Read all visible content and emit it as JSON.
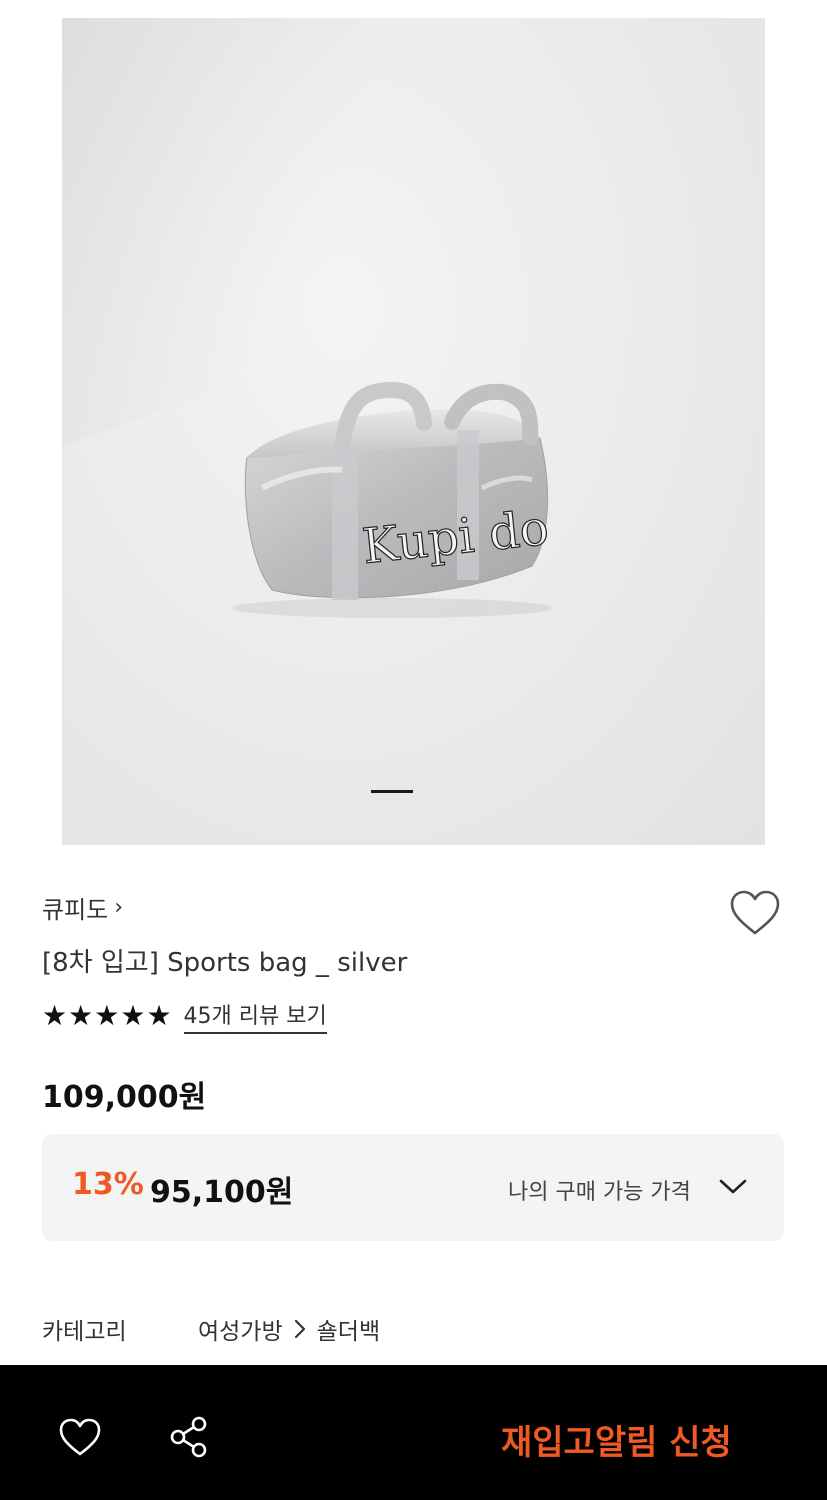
{
  "product_image": {
    "logo_text": "Kupi do",
    "carousel": {
      "current_index": 1,
      "total": 1
    }
  },
  "brand": {
    "name": "큐피도",
    "chevron": "›",
    "chevron_icon": "chevron-right-icon"
  },
  "wishlist_top": {
    "icon": "heart-outline-icon"
  },
  "product": {
    "title": "[8차 입고] Sports bag _ silver",
    "rating": {
      "stars": 5,
      "max": 5,
      "review_link": "45개 리뷰 보기"
    },
    "price": "109,000원"
  },
  "price_box": {
    "discount_rate": "13%",
    "discount_price": "95,100원",
    "label": "나의 구매 가능 가격",
    "toggle_icon": "chevron-down-icon"
  },
  "category": {
    "label": "카테고리",
    "path": [
      "여성가방",
      "숄더백"
    ],
    "separator_icon": "chevron-right-icon"
  },
  "bottom_bar": {
    "wish_icon": "heart-outline-icon",
    "share_icon": "share-icon",
    "cta_label": "재입고알림 신청"
  },
  "colors": {
    "accent": "#ef5a24",
    "bottom_bar_bg": "#000000",
    "price_box_bg": "#f4f4f4",
    "text_primary": "#111111"
  }
}
